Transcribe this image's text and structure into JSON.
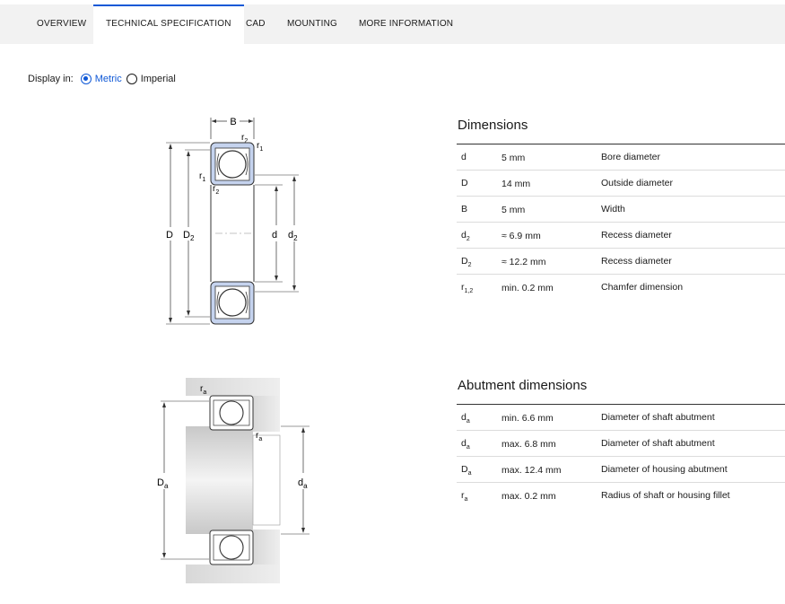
{
  "tabs": [
    {
      "label": "Overview",
      "active": false
    },
    {
      "label": "Technical specification",
      "active": true
    },
    {
      "label": "CAD",
      "active": false
    },
    {
      "label": "Mounting",
      "active": false
    },
    {
      "label": "More information",
      "active": false
    }
  ],
  "display": {
    "label": "Display in:",
    "options": [
      {
        "label": "Metric",
        "selected": true
      },
      {
        "label": "Imperial",
        "selected": false
      }
    ]
  },
  "dimensions": {
    "title": "Dimensions",
    "rows": [
      {
        "symbol": "d",
        "sub": "",
        "value": "5 mm",
        "description": "Bore diameter"
      },
      {
        "symbol": "D",
        "sub": "",
        "value": "14 mm",
        "description": "Outside diameter"
      },
      {
        "symbol": "B",
        "sub": "",
        "value": "5 mm",
        "description": "Width"
      },
      {
        "symbol": "d",
        "sub": "2",
        "value": "≈ 6.9 mm",
        "description": "Recess diameter"
      },
      {
        "symbol": "D",
        "sub": "2",
        "value": "≈ 12.2 mm",
        "description": "Recess diameter"
      },
      {
        "symbol": "r",
        "sub": "1,2",
        "value": "min. 0.2 mm",
        "description": "Chamfer dimension"
      }
    ]
  },
  "abutment": {
    "title": "Abutment dimensions",
    "rows": [
      {
        "symbol": "d",
        "sub": "a",
        "value": "min. 6.6 mm",
        "description": "Diameter of shaft abutment"
      },
      {
        "symbol": "d",
        "sub": "a",
        "value": "max. 6.8 mm",
        "description": "Diameter of shaft abutment"
      },
      {
        "symbol": "D",
        "sub": "a",
        "value": "max. 12.4 mm",
        "description": "Diameter of housing abutment"
      },
      {
        "symbol": "r",
        "sub": "a",
        "value": "max. 0.2 mm",
        "description": "Radius of shaft or housing fillet"
      }
    ]
  },
  "diagram1_labels": {
    "B": "B",
    "r2": "r",
    "r2_sub": "2",
    "r1": "r",
    "r1_sub": "1",
    "D": "D",
    "D2": "D",
    "D2_sub": "2",
    "d": "d",
    "d2": "d",
    "d2_sub": "2"
  },
  "diagram2_labels": {
    "ra": "r",
    "ra_sub": "a",
    "Da": "D",
    "Da_sub": "a",
    "da": "d",
    "da_sub": "a"
  },
  "colors": {
    "accent": "#0f58d6",
    "seal": "#c5d3ee"
  }
}
